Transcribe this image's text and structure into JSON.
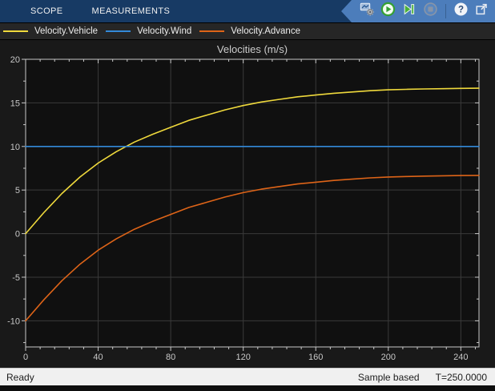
{
  "tabbar": {
    "tabs": [
      {
        "label": "SCOPE"
      },
      {
        "label": "MEASUREMENTS"
      }
    ]
  },
  "toolbar": {
    "buttons": [
      {
        "name": "scope-parameters",
        "icon": "scope-settings-icon"
      },
      {
        "name": "run",
        "icon": "play-icon"
      },
      {
        "name": "step-forward",
        "icon": "step-forward-icon"
      },
      {
        "name": "stop",
        "icon": "stop-icon",
        "disabled": true
      },
      {
        "name": "help",
        "icon": "help-icon"
      },
      {
        "name": "popout",
        "icon": "popout-icon"
      }
    ]
  },
  "legend": {
    "items": [
      {
        "label": "Velocity.Vehicle",
        "color": "#EFD93C"
      },
      {
        "label": "Velocity.Wind",
        "color": "#3389D8"
      },
      {
        "label": "Velocity.Advance",
        "color": "#DE6418"
      }
    ]
  },
  "chart_data": {
    "type": "line",
    "title": "Velocities (m/s)",
    "xlabel": "",
    "ylabel": "",
    "x": [
      0,
      10,
      20,
      30,
      40,
      50,
      60,
      70,
      80,
      90,
      100,
      110,
      120,
      130,
      140,
      150,
      160,
      170,
      180,
      190,
      200,
      210,
      220,
      230,
      240,
      250
    ],
    "series": [
      {
        "name": "Velocity.Vehicle",
        "color": "#EFD93C",
        "values": [
          0,
          2.4,
          4.6,
          6.5,
          8.1,
          9.4,
          10.5,
          11.4,
          12.2,
          13.0,
          13.6,
          14.2,
          14.7,
          15.1,
          15.4,
          15.7,
          15.9,
          16.1,
          16.25,
          16.4,
          16.5,
          16.55,
          16.6,
          16.63,
          16.66,
          16.68
        ]
      },
      {
        "name": "Velocity.Wind",
        "color": "#3389D8",
        "values": [
          10,
          10,
          10,
          10,
          10,
          10,
          10,
          10,
          10,
          10,
          10,
          10,
          10,
          10,
          10,
          10,
          10,
          10,
          10,
          10,
          10,
          10,
          10,
          10,
          10,
          10
        ]
      },
      {
        "name": "Velocity.Advance",
        "color": "#DE6418",
        "values": [
          -10,
          -7.6,
          -5.4,
          -3.5,
          -1.9,
          -0.6,
          0.5,
          1.4,
          2.2,
          3.0,
          3.6,
          4.2,
          4.7,
          5.1,
          5.4,
          5.7,
          5.9,
          6.1,
          6.25,
          6.4,
          6.5,
          6.55,
          6.6,
          6.63,
          6.66,
          6.68
        ]
      }
    ],
    "xlim": [
      0,
      250
    ],
    "ylim": [
      -13,
      20
    ],
    "xticks": [
      0,
      40,
      80,
      120,
      160,
      200,
      240
    ],
    "yticks": [
      -10,
      -5,
      0,
      5,
      10,
      15,
      20
    ],
    "x_minor_step": 8,
    "y_minor_step": 2.5,
    "grid": true,
    "legend_position": "top"
  },
  "colors": {
    "plot_bg": "#101010",
    "grid": "#3A3A3A",
    "axis": "#C8C8C8",
    "tick_label": "#C8C8C8",
    "title": "#CCCCCC",
    "tabbar_bg": "#173A64",
    "toolbar_bg": "#4C7DBB",
    "accent_green": "#35A033"
  },
  "statusbar": {
    "left": "Ready",
    "mode": "Sample based",
    "time": "T=250.0000"
  }
}
